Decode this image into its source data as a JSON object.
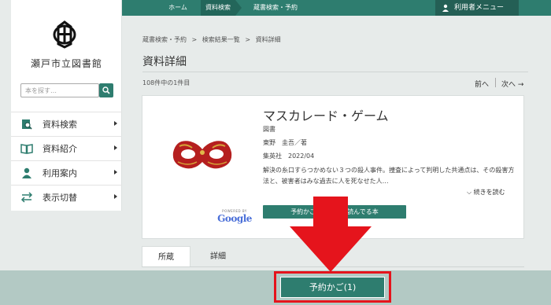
{
  "topnav": {
    "home": "ホーム",
    "current": "資料検索",
    "section": "蔵書検索・予約",
    "user_menu": "利用者メニュー"
  },
  "sidebar": {
    "library_name": "瀬戸市立図書館",
    "search_placeholder": "本を探す…",
    "items": [
      {
        "label": "資料検索",
        "icon": "book-search-icon"
      },
      {
        "label": "資料紹介",
        "icon": "open-book-icon"
      },
      {
        "label": "利用案内",
        "icon": "user-icon"
      },
      {
        "label": "表示切替",
        "icon": "swap-arrows-icon"
      }
    ]
  },
  "main": {
    "breadcrumb": [
      "蔵書検索・予約",
      ">",
      "検索結果一覧",
      ">",
      "資料詳細"
    ],
    "title": "資料詳細",
    "count": "108件中の1件目",
    "prev": "前へ",
    "next": "次へ →"
  },
  "book": {
    "title": "マスカレード・ゲーム",
    "type": "図書",
    "author": "東野　圭吾／著",
    "publisher": "集英社　2022/04",
    "description": "解決の糸口すらつかめない３つの殺人事件。捜査によって判明した共通点は、その殺害方法と、被害者はみな過去に人を死なせた人…",
    "more": "続きを読む",
    "action_button": "予約かごに入れる　読んでる本",
    "powered_by": "POWERED BY",
    "google": "Google"
  },
  "tabs": {
    "holdings": "所蔵",
    "details": "詳細"
  },
  "footer": {
    "reserve_button": "予約かご(1)"
  },
  "colors": {
    "accent": "#2e7d6f",
    "highlight": "#e5141c",
    "band": "#b3c9c4"
  }
}
